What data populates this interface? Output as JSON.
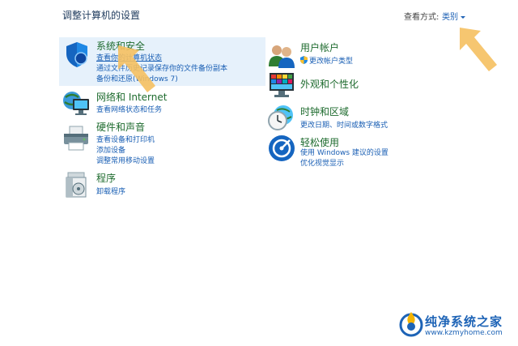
{
  "header": {
    "title": "调整计算机的设置",
    "view_by_label": "查看方式:",
    "view_by_value": "类别"
  },
  "categories": {
    "system_security": {
      "title": "系统和安全",
      "links": [
        "查看你的计算机状态",
        "通过文件历史记录保存你的文件备份副本",
        "备份和还原(Windows 7)"
      ]
    },
    "network": {
      "title": "网络和 Internet",
      "links": [
        "查看网络状态和任务"
      ]
    },
    "hardware": {
      "title": "硬件和声音",
      "links": [
        "查看设备和打印机",
        "添加设备",
        "调整常用移动设置"
      ]
    },
    "programs": {
      "title": "程序",
      "links": [
        "卸载程序"
      ]
    },
    "user_accounts": {
      "title": "用户帐户",
      "links": [
        "更改帐户类型"
      ]
    },
    "appearance": {
      "title": "外观和个性化",
      "links": []
    },
    "clock_region": {
      "title": "时钟和区域",
      "links": [
        "更改日期、时间或数字格式"
      ]
    },
    "ease_access": {
      "title": "轻松使用",
      "links": [
        "使用 Windows 建议的设置",
        "优化视觉显示"
      ]
    }
  },
  "watermark": {
    "text": "纯净系统之家",
    "url": "www.kzmyhome.com"
  },
  "colors": {
    "link": "#1a5fb4",
    "category_title": "#1e6b2e",
    "highlight": "#e6f1fb",
    "arrow": "#f5c060"
  }
}
